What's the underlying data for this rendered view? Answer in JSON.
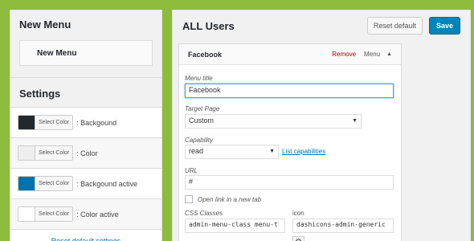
{
  "left": {
    "new_menu_title": "New Menu",
    "new_menu_item": "New Menu",
    "settings_title": "Settings",
    "color_rows": [
      {
        "picker_label": "Select Color",
        "swatch_color": "#23282d",
        "label": ": Backgound"
      },
      {
        "picker_label": "Select Color",
        "swatch_color": "#eeeeee",
        "label": ": Color"
      },
      {
        "picker_label": "Select Color",
        "swatch_color": "#0073aa",
        "label": ": Backgound active"
      },
      {
        "picker_label": "Select Color",
        "swatch_color": "#ffffff",
        "label": ": Color active"
      }
    ],
    "reset_link": "Reset default settings"
  },
  "right": {
    "title": "ALL Users",
    "reset_button": "Reset default",
    "save_button": "Save",
    "item": {
      "title": "Facebook",
      "remove_label": "Remove",
      "menu_label": "Menu",
      "toggle_icon": "caret-up-icon",
      "menu_title_label": "Menu title",
      "menu_title_value": "Facebook",
      "target_page_label": "Target Page",
      "target_page_value": "Custom",
      "capability_label": "Capability",
      "capability_value": "read",
      "capability_link": "List capabilities",
      "url_label": "URL",
      "url_value": "#",
      "new_tab_label": "Open link in a new tab",
      "css_classes_label": "CSS Classes",
      "css_classes_value": "admin-menu-class menu-t",
      "icon_label": "icon",
      "icon_value": "dashicons-admin-generic",
      "icon_button": "gear-icon"
    }
  }
}
